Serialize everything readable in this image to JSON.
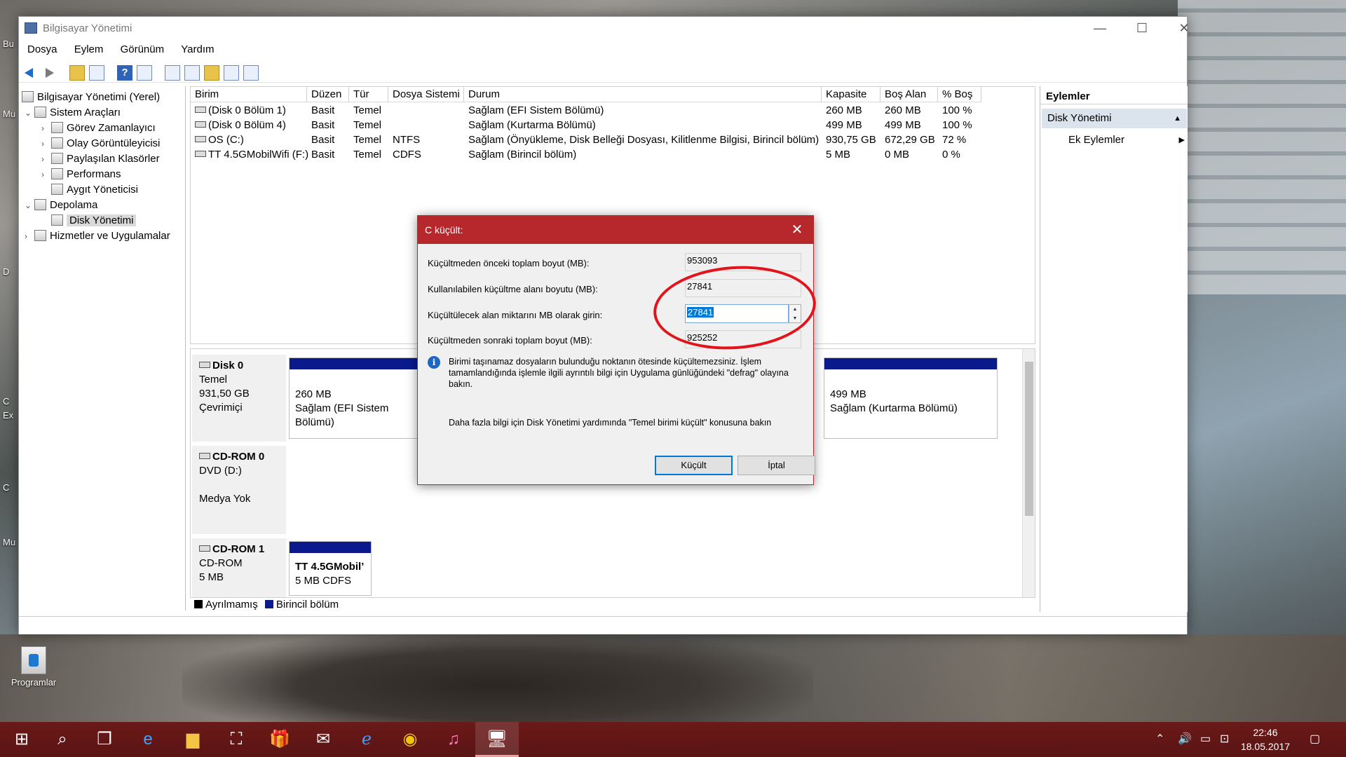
{
  "desktop": {
    "icon_label": "Programlar",
    "edge_texts": [
      "Bu",
      "Mu",
      "D",
      "C",
      "Ex",
      "C",
      "Mu"
    ]
  },
  "window": {
    "title": "Bilgisayar Yönetimi",
    "controls": {
      "minimize": "—",
      "maximize": "☐",
      "close": "✕"
    },
    "menu": [
      "Dosya",
      "Eylem",
      "Görünüm",
      "Yardım"
    ],
    "toolbar_help": "?"
  },
  "tree": {
    "root": "Bilgisayar Yönetimi (Yerel)",
    "system_tools": "Sistem Araçları",
    "task_scheduler": "Görev Zamanlayıcı",
    "event_viewer": "Olay Görüntüleyicisi",
    "shared_folders": "Paylaşılan Klasörler",
    "performance": "Performans",
    "device_manager": "Aygıt Yöneticisi",
    "storage": "Depolama",
    "disk_management": "Disk Yönetimi",
    "services": "Hizmetler ve Uygulamalar"
  },
  "volume_list": {
    "headers": [
      "Birim",
      "Düzen",
      "Tür",
      "Dosya Sistemi",
      "Durum",
      "Kapasite",
      "Boş Alan",
      "% Boş"
    ],
    "rows": [
      [
        "(Disk 0 Bölüm 1)",
        "Basit",
        "Temel",
        "",
        "Sağlam (EFI Sistem Bölümü)",
        "260 MB",
        "260 MB",
        "100 %"
      ],
      [
        "(Disk 0 Bölüm 4)",
        "Basit",
        "Temel",
        "",
        "Sağlam (Kurtarma Bölümü)",
        "499 MB",
        "499 MB",
        "100 %"
      ],
      [
        "OS (C:)",
        "Basit",
        "Temel",
        "NTFS",
        "Sağlam (Önyükleme, Disk Belleği Dosyası, Kilitlenme Bilgisi, Birincil bölüm)",
        "930,75 GB",
        "672,29 GB",
        "72 %"
      ],
      [
        "TT 4.5GMobilWifi (F:)",
        "Basit",
        "Temel",
        "CDFS",
        "Sağlam (Birincil bölüm)",
        "5 MB",
        "0 MB",
        "0 %"
      ]
    ]
  },
  "disk_map": {
    "disk0": {
      "name": "Disk 0",
      "type": "Temel",
      "size": "931,50 GB",
      "status": "Çevrimiçi",
      "part1_size": "260 MB",
      "part1_status": "Sağlam (EFI Sistem Bölümü)",
      "part4_size": "499 MB",
      "part4_status": "Sağlam (Kurtarma Bölümü)"
    },
    "cdrom0": {
      "name": "CD-ROM 0",
      "drive": "DVD (D:)",
      "status": "Medya Yok"
    },
    "cdrom1": {
      "name": "CD-ROM 1",
      "type": "CD-ROM",
      "size": "5 MB",
      "part_name": "TT 4.5GMobil’",
      "part_info": "5 MB CDFS"
    },
    "legend": {
      "unallocated": "Ayrılmamış",
      "primary": "Birincil bölüm",
      "unallocated_color": "#000000",
      "primary_color": "#0a1a8c"
    }
  },
  "actions": {
    "header": "Eylemler",
    "section": "Disk Yönetimi",
    "more": "Ek Eylemler"
  },
  "dialog": {
    "title": "C küçült:",
    "close": "✕",
    "total_before_label": "Küçültmeden önceki toplam boyut (MB):",
    "total_before": "953093",
    "available_label": "Kullanılabilen küçültme alanı boyutu (MB):",
    "available": "27841",
    "amount_label": "Küçültülecek alan miktarını MB olarak girin:",
    "amount": "27841",
    "total_after_label": "Küçültmeden sonraki toplam boyut (MB):",
    "total_after": "925252",
    "info_text": "Birimi taşınamaz dosyaların bulunduğu noktanın ötesinde küçültemezsiniz. İşlem tamamlandığında işlemle ilgili ayrıntılı bilgi için Uygulama günlüğündeki \"defrag\" olayına bakın.",
    "help_text": "Daha fazla bilgi için Disk Yönetimi yardımında \"Temel birimi küçült\" konusuna bakın",
    "shrink_button": "Küçült",
    "cancel_button": "İptal",
    "annotation_color": "#e2131a"
  },
  "taskbar": {
    "accent": "#5a1414",
    "time": "22:46",
    "date": "18.05.2017"
  }
}
